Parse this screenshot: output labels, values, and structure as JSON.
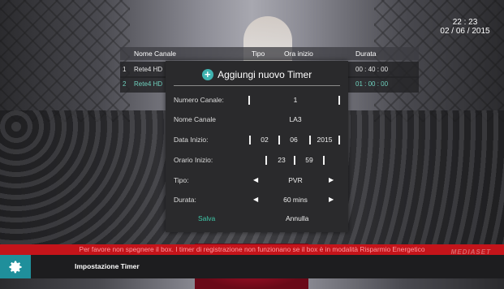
{
  "clock": {
    "time": "22 : 23",
    "date": "02 / 06 / 2015"
  },
  "list": {
    "headers": {
      "channel_name": "Nome Canale",
      "type": "Tipo",
      "start_time": "Ora inizio",
      "duration": "Durata"
    },
    "rows": [
      {
        "index": "1",
        "channel": "Rete4 HD",
        "duration": "00 : 40 : 00"
      },
      {
        "index": "2",
        "channel": "Rete4 HD",
        "duration": "01 : 00 : 00"
      }
    ]
  },
  "dialog": {
    "title": "Aggiungi nuovo Timer",
    "plus_icon": "+",
    "fields": {
      "channel_number": {
        "label": "Numero Canale:",
        "value": "1"
      },
      "channel_name": {
        "label": "Nome Canale",
        "value": "LA3"
      },
      "start_date": {
        "label": "Data Inizio:",
        "day": "02",
        "month": "06",
        "year": "2015"
      },
      "start_time": {
        "label": "Orario Inizio:",
        "hour": "23",
        "minute": "59"
      },
      "type": {
        "label": "Tipo:",
        "value": "PVR"
      },
      "duration": {
        "label": "Durata:",
        "value": "60 mins"
      }
    },
    "arrows": {
      "left": "◀",
      "right": "▶"
    },
    "save_label": "Salva",
    "cancel_label": "Annulla"
  },
  "warning": "Per favore non spegnere il box. I timer di registrazione non funzionano se il box è in modalità Risparmio Energetico",
  "footer": {
    "title": "Impostazione Timer",
    "icon": "gear-icon"
  },
  "brand": "MEDIASET",
  "colors": {
    "accent": "#1f8f9b",
    "save": "#3fc7a8",
    "warning_bg": "#c4141a"
  }
}
